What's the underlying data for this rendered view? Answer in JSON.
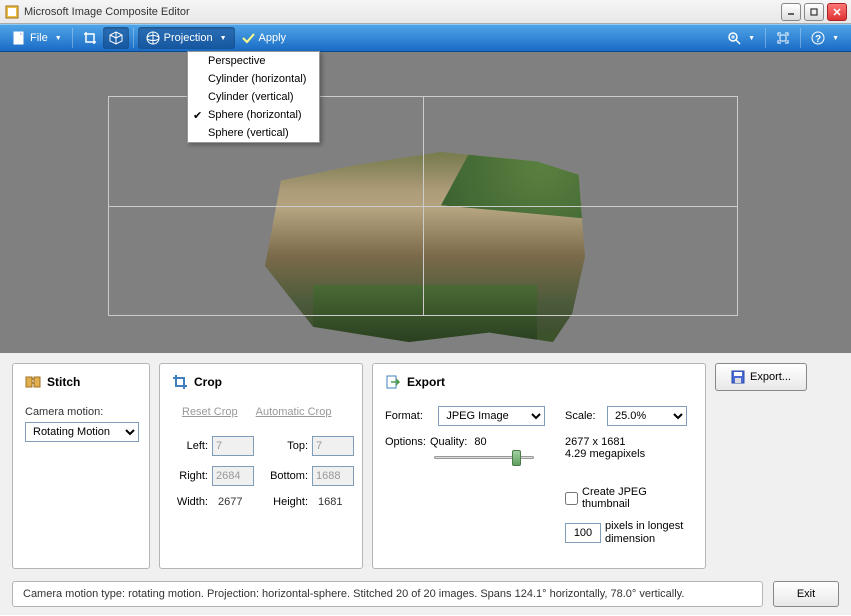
{
  "window": {
    "title": "Microsoft Image Composite Editor"
  },
  "toolbar": {
    "file_label": "File",
    "projection_label": "Projection",
    "apply_label": "Apply"
  },
  "projection_menu": {
    "items": [
      {
        "label": "Perspective",
        "checked": false
      },
      {
        "label": "Cylinder (horizontal)",
        "checked": false
      },
      {
        "label": "Cylinder (vertical)",
        "checked": false
      },
      {
        "label": "Sphere (horizontal)",
        "checked": true
      },
      {
        "label": "Sphere (vertical)",
        "checked": false
      }
    ]
  },
  "stitch": {
    "title": "Stitch",
    "camera_motion_label": "Camera motion:",
    "camera_motion_value": "Rotating Motion"
  },
  "crop": {
    "title": "Crop",
    "reset_label": "Reset Crop",
    "auto_label": "Automatic Crop",
    "left_label": "Left:",
    "left_value": "7",
    "top_label": "Top:",
    "top_value": "7",
    "right_label": "Right:",
    "right_value": "2684",
    "bottom_label": "Bottom:",
    "bottom_value": "1688",
    "width_label": "Width:",
    "width_value": "2677",
    "height_label": "Height:",
    "height_value": "1681"
  },
  "export": {
    "title": "Export",
    "format_label": "Format:",
    "format_value": "JPEG Image",
    "options_label": "Options:",
    "quality_label": "Quality:",
    "quality_value": "80",
    "scale_label": "Scale:",
    "scale_value": "25.0%",
    "dims_text": "2677 x 1681",
    "mp_text": "4.29 megapixels",
    "thumbnail_label": "Create JPEG thumbnail",
    "thumb_px": "100",
    "thumb_suffix": "pixels in longest dimension",
    "export_button": "Export..."
  },
  "status": {
    "text": "Camera motion type: rotating motion. Projection: horizontal-sphere. Stitched 20 of 20 images. Spans 124.1° horizontally, 78.0° vertically.",
    "exit_label": "Exit"
  }
}
